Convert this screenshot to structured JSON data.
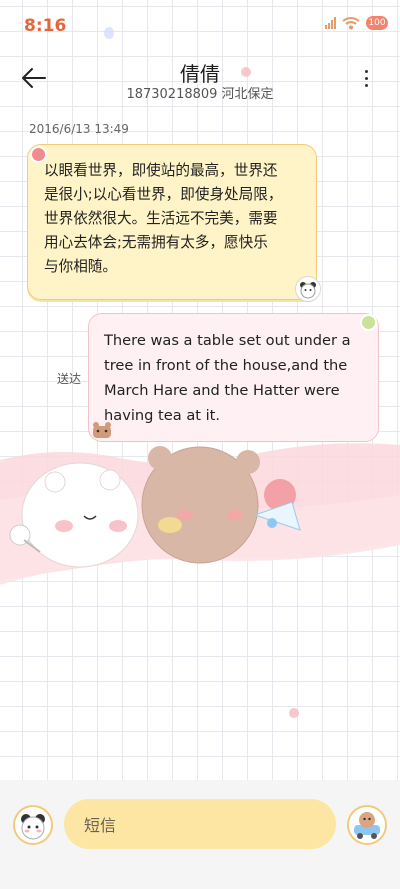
{
  "status_bar": {
    "time": "8:16",
    "battery": "100"
  },
  "header": {
    "name": "倩倩",
    "subtitle": "18730218809 河北保定"
  },
  "conversation": {
    "timestamp": "2016/6/13 13:49",
    "incoming_lines": [
      "以眼看世界，即使站的最高，世界还",
      "是很小;以心看世界，即使身处局限，",
      "世界依然很大。生活远不完美，需要",
      "用心去体会;无需拥有太多，愿快乐",
      "与你相随。"
    ],
    "outgoing_lines": [
      "There was a table set out under a",
      "tree in front of the house,and the",
      "March Hare and the Hatter were",
      "having tea at it."
    ],
    "delivery_status": "送达"
  },
  "composer": {
    "placeholder": "短信"
  },
  "colors": {
    "accent": "#e4663a",
    "incoming_bubble": "#fff4c7",
    "outgoing_bubble": "#fff1f3",
    "input_bg": "#fde5a3"
  },
  "icons": {
    "back": "arrow-left-icon",
    "more": "more-vertical-icon",
    "attach": "panda-avatar-icon",
    "send": "bear-car-icon"
  }
}
